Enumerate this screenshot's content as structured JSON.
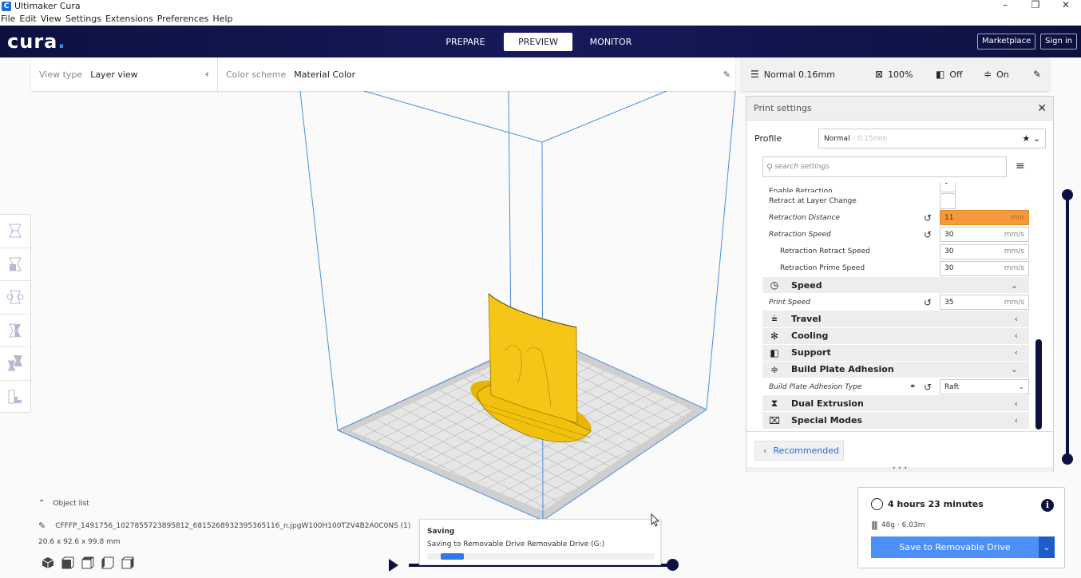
{
  "window": {
    "title": "Ultimaker Cura",
    "controls": [
      "minimize",
      "restore",
      "close"
    ]
  },
  "menu": [
    "File",
    "Edit",
    "View",
    "Settings",
    "Extensions",
    "Preferences",
    "Help"
  ],
  "header": {
    "logo": "cura",
    "stages": [
      {
        "label": "PREPARE",
        "active": false
      },
      {
        "label": "PREVIEW",
        "active": true
      },
      {
        "label": "MONITOR",
        "active": false
      }
    ],
    "marketplace_label": "Marketplace",
    "signin_label": "Sign in"
  },
  "view_toolbar": {
    "view_type_label": "View type",
    "view_type_value": "Layer view",
    "color_scheme_label": "Color scheme",
    "color_scheme_value": "Material Color"
  },
  "print_summary": {
    "profile": "Normal 0.16mm",
    "infill": "100%",
    "support": "Off",
    "adhesion": "On"
  },
  "left_tools": [
    "move-tool",
    "scale-tool",
    "rotate-tool",
    "mirror-tool",
    "per-model-settings-tool",
    "support-blocker-tool"
  ],
  "print_settings": {
    "title": "Print settings",
    "profile_label": "Profile",
    "profile_value": "Normal",
    "profile_sub": "- 0.15mm",
    "search_placeholder": "search settings",
    "rows": [
      {
        "type": "setting",
        "name": "Enable Retraction",
        "control": "checkbox",
        "checked": true
      },
      {
        "type": "setting",
        "name": "Retract at Layer Change",
        "control": "checkbox",
        "checked": false
      },
      {
        "type": "setting",
        "name": "Retraction Distance",
        "italic": true,
        "reset": true,
        "value": "11",
        "unit": "mm",
        "warning": true
      },
      {
        "type": "setting",
        "name": "Retraction Speed",
        "italic": true,
        "reset": true,
        "value": "30",
        "unit": "mm/s"
      },
      {
        "type": "setting",
        "name": "Retraction Retract Speed",
        "indent": true,
        "value": "30",
        "unit": "mm/s"
      },
      {
        "type": "setting",
        "name": "Retraction Prime Speed",
        "indent": true,
        "value": "30",
        "unit": "mm/s"
      },
      {
        "type": "category",
        "name": "Speed",
        "icon": "speed-icon",
        "expanded": true
      },
      {
        "type": "setting",
        "name": "Print Speed",
        "italic": true,
        "reset": true,
        "value": "35",
        "unit": "mm/s"
      },
      {
        "type": "category",
        "name": "Travel",
        "icon": "travel-icon",
        "expanded": false
      },
      {
        "type": "category",
        "name": "Cooling",
        "icon": "cooling-icon",
        "expanded": false
      },
      {
        "type": "category",
        "name": "Support",
        "icon": "support-icon",
        "expanded": false
      },
      {
        "type": "category",
        "name": "Build Plate Adhesion",
        "icon": "adhesion-icon",
        "expanded": true
      },
      {
        "type": "setting",
        "name": "Build Plate Adhesion Type",
        "italic": true,
        "reset": true,
        "linked": true,
        "control": "select",
        "value": "Raft"
      },
      {
        "type": "category",
        "name": "Dual Extrusion",
        "icon": "dual-extrusion-icon",
        "expanded": false
      },
      {
        "type": "category",
        "name": "Special Modes",
        "icon": "special-modes-icon",
        "expanded": false
      }
    ],
    "recommended_label": "Recommended"
  },
  "object_list": {
    "header": "Object list",
    "file_name": "CFFFP_1491756_1027855723895812_6815268932395365116_n.jpgW100H100T2V4B2A0C0NS (1)",
    "dimensions": "20.6 x 92.6 x 99.8 mm"
  },
  "view_cubes": [
    "3d-view",
    "front-view",
    "top-view",
    "left-view",
    "right-view"
  ],
  "toast": {
    "title": "Saving",
    "message": "Saving to Removable Drive Removable Drive (G:)",
    "progress_indeterminate": true
  },
  "output": {
    "print_time": "4 hours 23 minutes",
    "material": "48g · 6.03m",
    "save_label": "Save to Removable Drive"
  },
  "colors": {
    "header_bg": "#0d1140",
    "accent_blue": "#4d90f5",
    "warning_orange": "#f59a3a",
    "model_yellow": "#f5c518",
    "build_volume_line": "#4a90e2"
  }
}
